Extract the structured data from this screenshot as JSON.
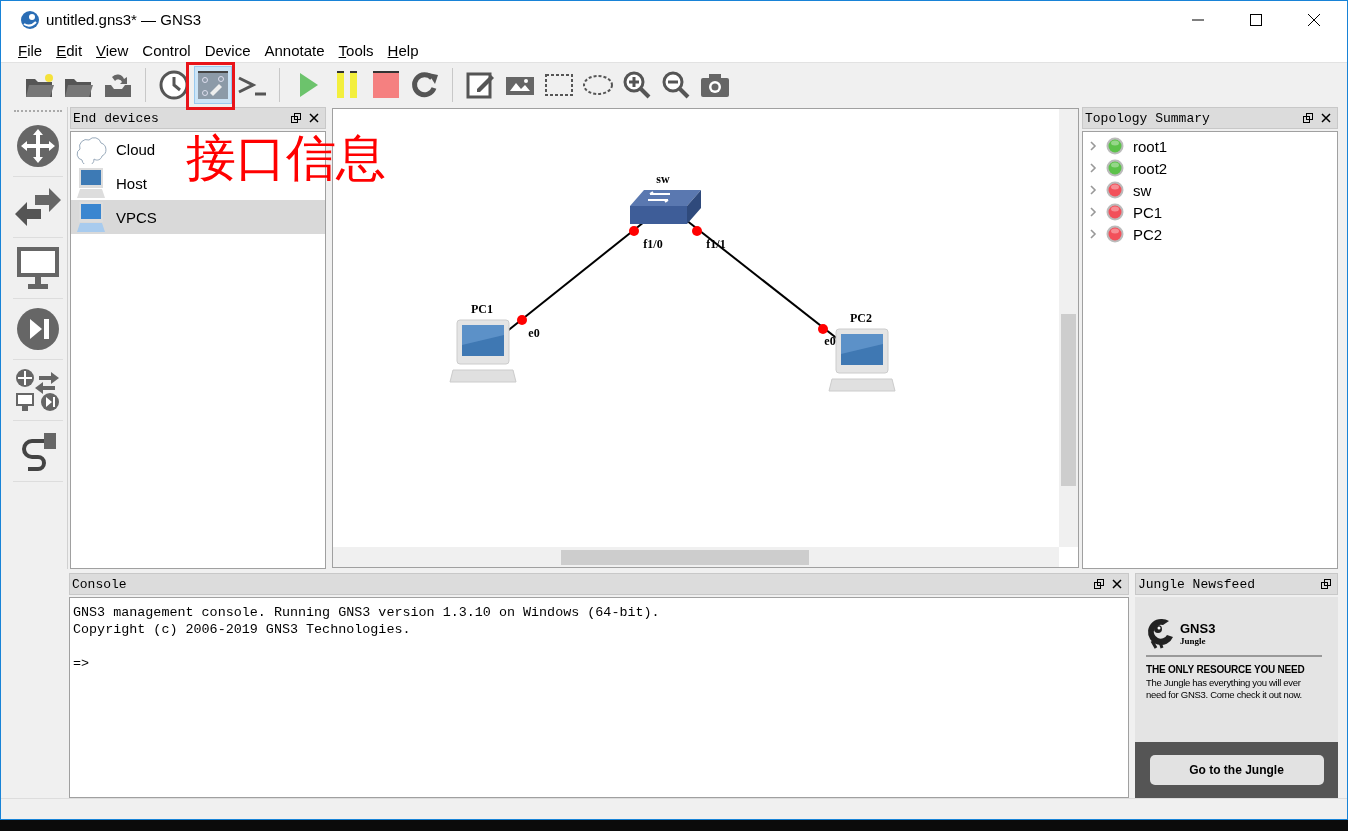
{
  "window": {
    "title": "untitled.gns3* — GNS3"
  },
  "menu": [
    {
      "label": "File",
      "mnemonic": true
    },
    {
      "label": "Edit",
      "mnemonic": true
    },
    {
      "label": "View",
      "mnemonic": true
    },
    {
      "label": "Control",
      "mnemonic": false
    },
    {
      "label": "Device",
      "mnemonic": false
    },
    {
      "label": "Annotate",
      "mnemonic": false
    },
    {
      "label": "Tools",
      "mnemonic": true
    },
    {
      "label": "Help",
      "mnemonic": true
    }
  ],
  "toolbar": [
    {
      "kind": "new-project",
      "checked": false
    },
    {
      "kind": "open",
      "checked": false
    },
    {
      "kind": "save",
      "checked": false
    },
    {
      "kind": "separator"
    },
    {
      "kind": "clock",
      "checked": false
    },
    {
      "kind": "interface-labels",
      "checked": true
    },
    {
      "kind": "console",
      "checked": false
    },
    {
      "kind": "separator"
    },
    {
      "kind": "start",
      "checked": false
    },
    {
      "kind": "suspend",
      "checked": false
    },
    {
      "kind": "stop",
      "checked": false
    },
    {
      "kind": "reload",
      "checked": false
    },
    {
      "kind": "separator"
    },
    {
      "kind": "note",
      "checked": false
    },
    {
      "kind": "image",
      "checked": false
    },
    {
      "kind": "rectangle",
      "checked": false
    },
    {
      "kind": "ellipse",
      "checked": false
    },
    {
      "kind": "zoom-in",
      "checked": false
    },
    {
      "kind": "zoom-out",
      "checked": false
    },
    {
      "kind": "screenshot",
      "checked": false
    }
  ],
  "annotation": {
    "text": "接口信息"
  },
  "end_devices": {
    "title": "End devices",
    "items": [
      {
        "kind": "cloud",
        "label": "Cloud",
        "selected": false
      },
      {
        "kind": "host",
        "label": "Host",
        "selected": false
      },
      {
        "kind": "vpcs",
        "label": "VPCS",
        "selected": true
      }
    ]
  },
  "topology": {
    "nodes": [
      {
        "kind": "switch",
        "name": "sw"
      },
      {
        "kind": "pc",
        "name": "PC1"
      },
      {
        "kind": "pc",
        "name": "PC2"
      }
    ],
    "links": [
      {
        "ports": [
          "f1/0",
          "e0"
        ]
      },
      {
        "ports": [
          "f1/1",
          "e0"
        ]
      }
    ]
  },
  "topology_summary": {
    "title": "Topology Summary",
    "items": [
      {
        "name": "root1",
        "running": true
      },
      {
        "name": "root2",
        "running": true
      },
      {
        "name": "sw",
        "running": false
      },
      {
        "name": "PC1",
        "running": false
      },
      {
        "name": "PC2",
        "running": false
      }
    ]
  },
  "console": {
    "title": "Console",
    "lines": [
      "GNS3 management console. Running GNS3 version 1.3.10 on Windows (64-bit).",
      "Copyright (c) 2006-2019 GNS3 Technologies."
    ],
    "prompt": "=>"
  },
  "jungle_newsfeed": {
    "title": "Jungle Newsfeed",
    "brand": "GNS3",
    "sub_brand": "Jungle",
    "heading": "THE ONLY RESOURCE YOU NEED",
    "body": "The Jungle has everything you will ever need for GNS3. Come check it out now.",
    "button": "Go to the Jungle"
  }
}
